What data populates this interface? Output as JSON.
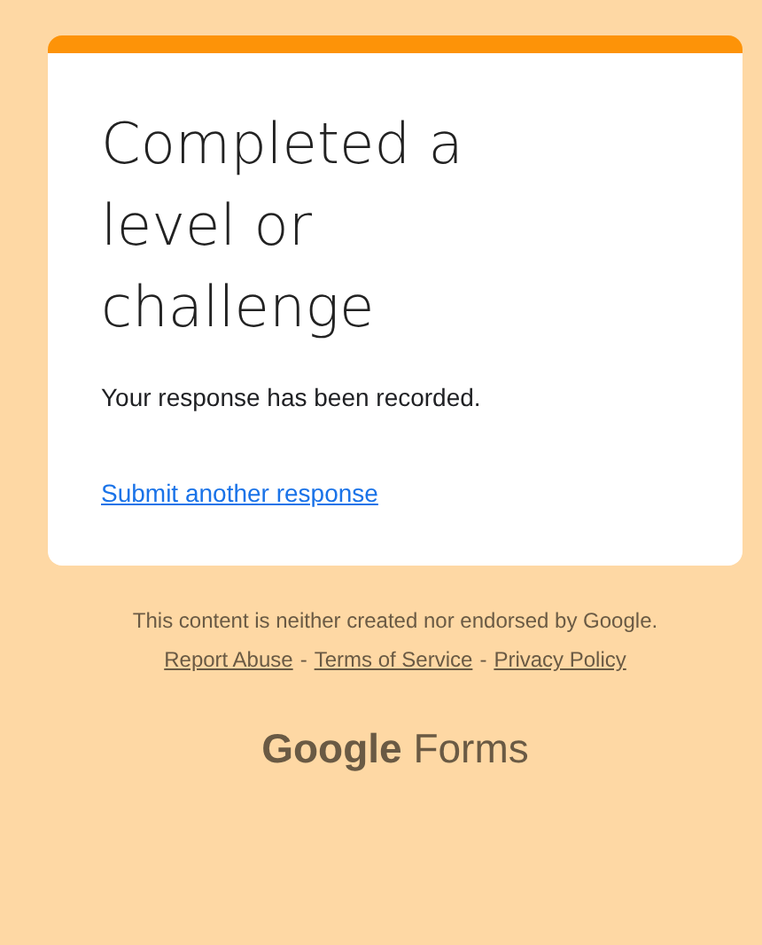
{
  "card": {
    "title": "Completed a level or challenge",
    "message": "Your response has been recorded.",
    "link": "Submit another response"
  },
  "footer": {
    "disclaimer": "This content is neither created nor endorsed by Google.",
    "links": [
      "Report Abuse",
      "Terms of Service",
      "Privacy Policy"
    ],
    "separator": "-",
    "logo": "**Google** Forms"
  }
}
